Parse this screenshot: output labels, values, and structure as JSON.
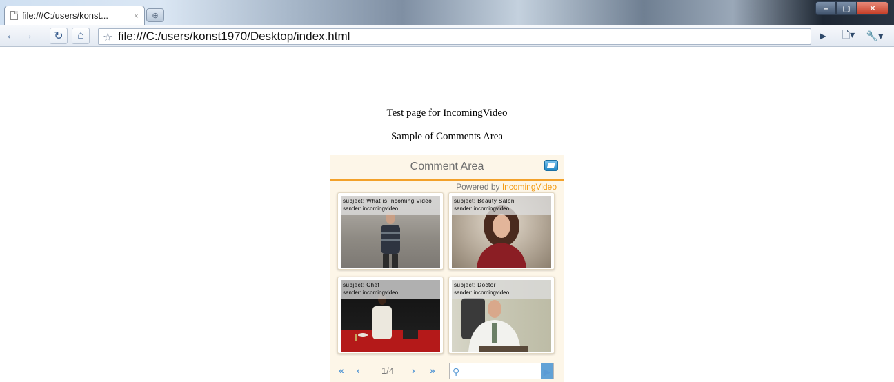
{
  "browser": {
    "tab_title": "file:///C:/users/konst...",
    "tab_close": "×",
    "address": "file:///C:/users/konst1970/Desktop/index.html"
  },
  "page": {
    "heading": "Test page for IncomingVideo",
    "subheading": "Sample of Comments Area"
  },
  "widget": {
    "title": "Comment Area",
    "powered_prefix": "Powered by ",
    "powered_brand": "IncomingVideo",
    "accent_color": "#f3a12a",
    "videos": [
      {
        "subject": "subject: What is Incoming Video",
        "sender": "sender: incomingvideo"
      },
      {
        "subject": "subject: Beauty Salon",
        "sender": "sender: incomingvideo"
      },
      {
        "subject": "subject: Chef",
        "sender": "sender: incomingvideo"
      },
      {
        "subject": "subject: Doctor",
        "sender": "sender: incomingvideo"
      }
    ],
    "pager": {
      "first": "«",
      "prev": "‹",
      "page": "1/4",
      "next": "›",
      "last": "»"
    }
  }
}
